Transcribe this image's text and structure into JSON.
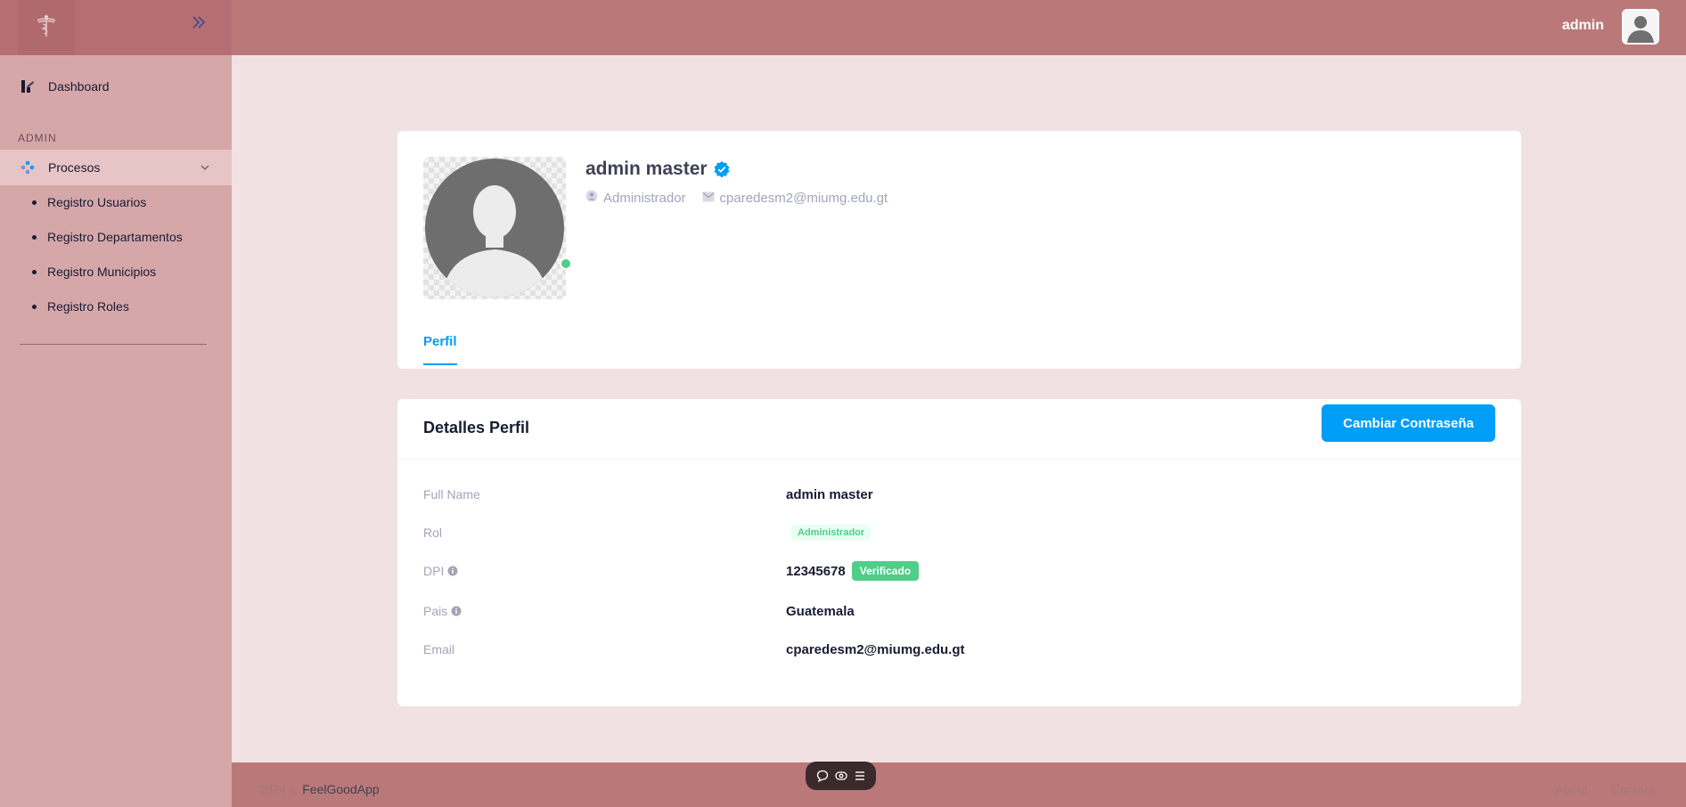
{
  "header": {
    "user_name": "admin"
  },
  "sidebar": {
    "dashboard_label": "Dashboard",
    "section_label": "ADMIN",
    "procesos_label": "Procesos",
    "sub_items": [
      {
        "label": "Registro Usuarios"
      },
      {
        "label": "Registro Departamentos"
      },
      {
        "label": "Registro Municipios"
      },
      {
        "label": "Registro Roles"
      }
    ]
  },
  "profile": {
    "name": "admin master",
    "role": "Administrador",
    "email": "cparedesm2@miumg.edu.gt",
    "tab_label": "Perfil"
  },
  "details": {
    "title": "Detalles Perfil",
    "button_label": "Cambiar Contraseña",
    "rows": {
      "full_name": {
        "label": "Full Name",
        "value": "admin master"
      },
      "rol": {
        "label": "Rol",
        "value": "Administrador"
      },
      "dpi": {
        "label": "DPI",
        "value": "12345678",
        "badge": "Verificado"
      },
      "pais": {
        "label": "Pais",
        "value": "Guatemala"
      },
      "email": {
        "label": "Email",
        "value": "cparedesm2@miumg.edu.gt"
      }
    }
  },
  "footer": {
    "year": "2024 ©",
    "app_name": "FeelGoodApp",
    "links": [
      "About",
      "Contact"
    ]
  },
  "colors": {
    "header": "#bb7879",
    "sidebar": "#d6a7a9",
    "accent": "#009ef7",
    "success": "#50cd89"
  },
  "icons": [
    "caduceus-icon",
    "double-chevron-right-icon",
    "dashboard-icon",
    "procesos-icon",
    "chevron-down-icon",
    "verified-icon",
    "user-icon",
    "mail-icon",
    "info-icon",
    "chat-icon",
    "eye-icon",
    "menu-icon"
  ]
}
